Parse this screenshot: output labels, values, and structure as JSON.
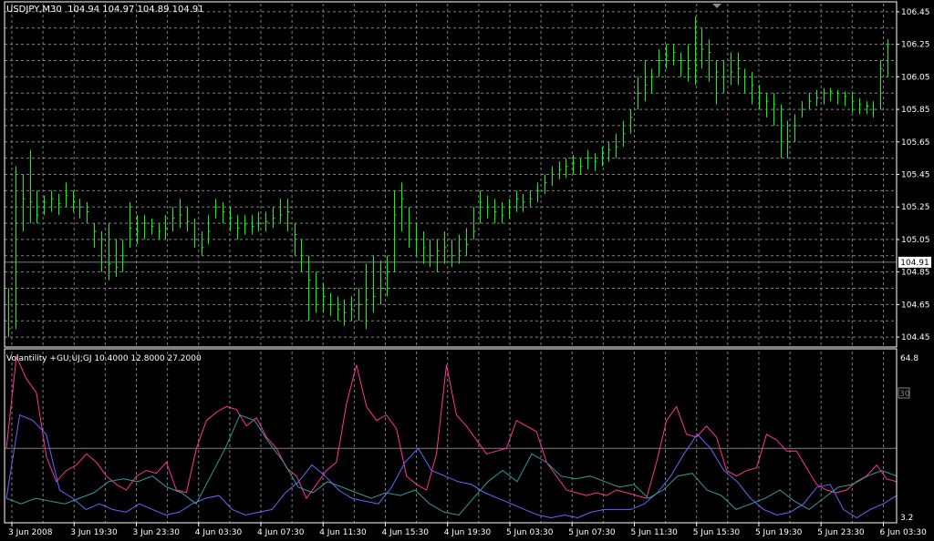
{
  "header": {
    "symbol": "USDJPY,M30",
    "ohlc": "104.94 104.97 104.89 104.91"
  },
  "indicator": {
    "label": "Volantility +GU;UJ;GJ 10.4000 12.8000 27.2000",
    "level_label": "30",
    "max_label": "64.8",
    "min_label": "3.2"
  },
  "current_price_label": "104.91",
  "colors": {
    "background": "#000000",
    "grid": "#7f7f7f",
    "bar": "#00ff00",
    "frame": "#ffffff",
    "gu_line": "#ff3399",
    "uj_line": "#6666ff",
    "gj_line": "#339999",
    "price_tag_bg": "#ffffff",
    "price_tag_fg": "#000000"
  },
  "chart_data": [
    {
      "type": "bar",
      "name_shown": "USDJPY,M30",
      "ylim": [
        104.4,
        106.5
      ],
      "y_ticks": [
        "106.45",
        "106.25",
        "106.05",
        "105.85",
        "105.65",
        "105.45",
        "105.25",
        "105.05",
        "104.85",
        "104.65",
        "104.45"
      ],
      "x_ticks": [
        "3 Jun 2008",
        "3 Jun 19:30",
        "3 Jun 23:30",
        "4 Jun 03:30",
        "4 Jun 07:30",
        "4 Jun 11:30",
        "4 Jun 15:30",
        "4 Jun 19:30",
        "5 Jun 03:30",
        "5 Jun 07:30",
        "5 Jun 11:30",
        "5 Jun 15:30",
        "5 Jun 19:30",
        "5 Jun 23:30",
        "6 Jun 03:30"
      ],
      "last_price": 104.91,
      "close": [
        104.5,
        105.15,
        105.3,
        105.28,
        105.2,
        105.28,
        105.3,
        105.27,
        105.32,
        105.28,
        105.25,
        105.22,
        105.1,
        105.05,
        104.9,
        104.88,
        104.95,
        105.12,
        105.1,
        105.15,
        105.13,
        105.1,
        105.12,
        105.18,
        105.2,
        105.16,
        105.05,
        105.0,
        105.1,
        105.25,
        105.22,
        105.18,
        105.12,
        105.14,
        105.13,
        105.15,
        105.16,
        105.18,
        105.2,
        105.22,
        105.08,
        104.95,
        104.8,
        104.75,
        104.7,
        104.65,
        104.62,
        104.6,
        104.62,
        104.65,
        104.68,
        104.7,
        104.75,
        104.85,
        105.2,
        105.3,
        105.15,
        105.05,
        105.0,
        104.95,
        104.98,
        105.0,
        104.95,
        104.98,
        105.02,
        105.1,
        105.28,
        105.25,
        105.22,
        105.2,
        105.25,
        105.3,
        105.28,
        105.3,
        105.35,
        105.4,
        105.45,
        105.48,
        105.5,
        105.52,
        105.5,
        105.55,
        105.53,
        105.58,
        105.6,
        105.62,
        105.7,
        105.8,
        105.95,
        106.0,
        106.05,
        106.15,
        106.18,
        106.2,
        106.15,
        106.1,
        106.12,
        106.22,
        106.2,
        106.08,
        106.05,
        106.08,
        106.1,
        106.05,
        106.0,
        105.95,
        105.9,
        105.88,
        105.85,
        105.65,
        105.75,
        105.85,
        105.9,
        105.92,
        105.95,
        105.96,
        105.95,
        105.93,
        105.9,
        105.88,
        105.87,
        105.85,
        106.1,
        106.25
      ],
      "high": [
        104.75,
        105.5,
        105.45,
        105.6,
        105.35,
        105.32,
        105.35,
        105.33,
        105.4,
        105.35,
        105.3,
        105.28,
        105.15,
        105.1,
        105.15,
        105.05,
        105.05,
        105.28,
        105.2,
        105.2,
        105.18,
        105.15,
        105.2,
        105.25,
        105.3,
        105.25,
        105.18,
        105.1,
        105.2,
        105.3,
        105.28,
        105.25,
        105.2,
        105.2,
        105.2,
        105.22,
        105.22,
        105.25,
        105.3,
        105.3,
        105.15,
        105.05,
        104.95,
        104.85,
        104.78,
        104.72,
        104.7,
        104.68,
        104.7,
        104.75,
        104.9,
        104.95,
        104.92,
        104.95,
        105.35,
        105.4,
        105.25,
        105.15,
        105.1,
        105.05,
        105.05,
        105.1,
        105.05,
        105.08,
        105.12,
        105.25,
        105.35,
        105.32,
        105.3,
        105.28,
        105.3,
        105.35,
        105.33,
        105.35,
        105.4,
        105.45,
        105.5,
        105.53,
        105.55,
        105.57,
        105.55,
        105.6,
        105.58,
        105.62,
        105.65,
        105.7,
        105.78,
        105.85,
        106.05,
        106.15,
        106.1,
        106.22,
        106.25,
        106.25,
        106.2,
        106.25,
        106.42,
        106.35,
        106.28,
        106.15,
        106.15,
        106.2,
        106.2,
        106.1,
        106.08,
        106.0,
        105.95,
        105.95,
        105.88,
        105.78,
        105.82,
        105.9,
        105.95,
        105.97,
        105.98,
        105.98,
        105.97,
        105.96,
        105.95,
        105.92,
        105.9,
        105.9,
        106.15,
        106.28
      ],
      "low": [
        104.45,
        104.5,
        105.1,
        105.15,
        105.15,
        105.2,
        105.22,
        105.2,
        105.25,
        105.22,
        105.18,
        105.15,
        105.0,
        104.85,
        104.8,
        104.82,
        104.85,
        105.0,
        105.02,
        105.05,
        105.08,
        105.05,
        105.05,
        105.1,
        105.12,
        105.1,
        105.0,
        104.95,
        105.02,
        105.18,
        105.15,
        105.1,
        105.05,
        105.08,
        105.08,
        105.1,
        105.1,
        105.12,
        105.15,
        105.1,
        104.95,
        104.85,
        104.55,
        104.6,
        104.6,
        104.58,
        104.55,
        104.52,
        104.55,
        104.55,
        104.5,
        104.6,
        104.65,
        104.7,
        104.85,
        105.1,
        105.0,
        104.95,
        104.9,
        104.88,
        104.85,
        104.9,
        104.88,
        104.9,
        104.95,
        105.05,
        105.15,
        105.18,
        105.15,
        105.15,
        105.18,
        105.22,
        105.22,
        105.25,
        105.28,
        105.33,
        105.38,
        105.42,
        105.43,
        105.45,
        105.45,
        105.48,
        105.47,
        105.5,
        105.53,
        105.55,
        105.62,
        105.7,
        105.85,
        105.9,
        105.95,
        106.05,
        106.1,
        106.12,
        106.05,
        106.02,
        106.0,
        106.1,
        106.02,
        105.88,
        105.95,
        106.0,
        106.0,
        105.95,
        105.88,
        105.85,
        105.8,
        105.75,
        105.55,
        105.55,
        105.65,
        105.8,
        105.85,
        105.87,
        105.88,
        105.9,
        105.88,
        105.87,
        105.83,
        105.82,
        105.82,
        105.8,
        105.85,
        106.05
      ]
    },
    {
      "type": "line",
      "name_shown": "Volantility +GU;UJ;GJ",
      "ylim": [
        3.2,
        64.8
      ],
      "level": 30,
      "series": [
        {
          "name": "GU",
          "values": [
            30,
            63,
            55,
            50,
            27,
            18,
            22,
            24,
            28,
            25,
            20,
            17,
            15,
            20,
            22,
            21,
            25,
            15,
            14,
            30,
            40,
            43,
            45,
            44,
            38,
            41,
            34,
            30,
            23,
            20,
            12,
            17,
            22,
            25,
            46,
            60,
            45,
            40,
            42,
            37,
            20,
            17,
            15,
            28,
            60,
            42,
            38,
            33,
            28,
            29,
            30,
            40,
            38,
            36,
            25,
            20,
            15,
            14,
            13,
            14,
            13,
            15,
            14,
            13,
            12,
            25,
            40,
            45,
            35,
            34,
            38,
            34,
            22,
            20,
            22,
            23,
            35,
            33,
            29,
            29,
            23,
            17,
            15,
            14,
            15,
            18,
            20,
            24,
            19,
            18
          ]
        },
        {
          "name": "UJ",
          "values": [
            12,
            42,
            40,
            35,
            15,
            12,
            8,
            10,
            8,
            7,
            10,
            8,
            6,
            7,
            10,
            12,
            13,
            8,
            6,
            7,
            8,
            14,
            18,
            24,
            20,
            15,
            12,
            11,
            10,
            16,
            25,
            30,
            22,
            20,
            18,
            17,
            14,
            12,
            10,
            8,
            6,
            5,
            6,
            5,
            7,
            8,
            8,
            8,
            10,
            14,
            20,
            28,
            35,
            30,
            22,
            18,
            12,
            8,
            6,
            7,
            10,
            16,
            17,
            8,
            5,
            8,
            10,
            13
          ]
        },
        {
          "name": "GJ",
          "values": [
            12,
            10,
            12,
            11,
            10,
            12,
            14,
            18,
            19,
            18,
            20,
            16,
            14,
            10,
            20,
            30,
            42,
            40,
            32,
            25,
            16,
            14,
            18,
            16,
            14,
            12,
            14,
            13,
            15,
            10,
            7,
            6,
            12,
            18,
            22,
            18,
            28,
            25,
            20,
            19,
            20,
            18,
            16,
            17,
            12,
            15,
            20,
            21,
            15,
            13,
            8,
            10,
            12,
            15,
            11,
            8,
            12,
            16,
            17,
            20,
            22,
            20
          ]
        }
      ]
    }
  ]
}
